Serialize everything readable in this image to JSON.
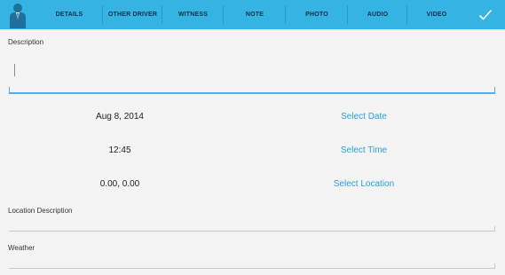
{
  "colors": {
    "header_bg": "#35b4e3",
    "link": "#2a9fe0",
    "active_underline": "#5aa9e8",
    "inactive_underline": "#cccccc",
    "background": "#f4f4f4"
  },
  "header": {
    "app_icon": "person-in-suit-icon",
    "tabs": [
      {
        "label": "DETAILS"
      },
      {
        "label": "OTHER DRIVER"
      },
      {
        "label": "WITNESS"
      },
      {
        "label": "NOTE"
      },
      {
        "label": "PHOTO"
      },
      {
        "label": "AUDIO"
      },
      {
        "label": "VIDEO"
      }
    ],
    "done_icon": "checkmark-icon"
  },
  "form": {
    "description": {
      "label": "Description",
      "value": ""
    },
    "date": {
      "value": "Aug 8, 2014",
      "action": "Select Date"
    },
    "time": {
      "value": "12:45",
      "action": "Select Time"
    },
    "location": {
      "value": "0.00, 0.00",
      "action": "Select Location"
    },
    "location_description": {
      "label": "Location Description",
      "value": ""
    },
    "weather": {
      "label": "Weather",
      "value": ""
    }
  }
}
